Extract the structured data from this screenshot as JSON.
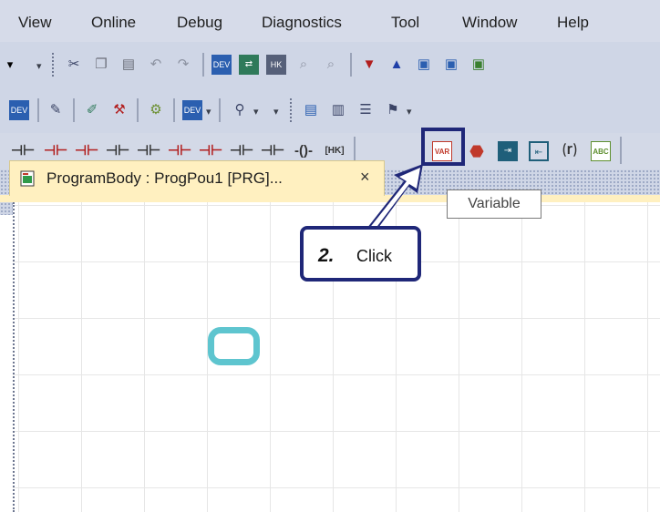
{
  "menu": {
    "items": [
      "View",
      "Online",
      "Debug",
      "Diagnostics",
      "Tool",
      "Window",
      "Help"
    ]
  },
  "toolbar_row3": {
    "icons": [
      "contact-no-icon",
      "contact-nc-icon",
      "contact-rise-icon",
      "contact-fall-icon",
      "contact-parallel-no-icon",
      "contact-parallel-nc-icon",
      "contact-parallel-rise-icon",
      "contact-parallel-fall-icon",
      "contact-parallel-fall2-icon",
      "coil-icon",
      "function-block-icon",
      "variable-icon",
      "operator-icon",
      "input-icon",
      "output-icon",
      "return-icon",
      "comment-icon"
    ]
  },
  "tab": {
    "label": "ProgramBody : ProgPou1 [PRG]...",
    "close": "×"
  },
  "tooltip": {
    "text": "Variable"
  },
  "callout": {
    "step": "2.",
    "text": "Click"
  },
  "colors": {
    "highlight_border": "#1f2778",
    "cursor_ring": "#5ec5cf",
    "tab_bg": "#fff0c0",
    "toolbar_bg": "#cfd6e6"
  }
}
